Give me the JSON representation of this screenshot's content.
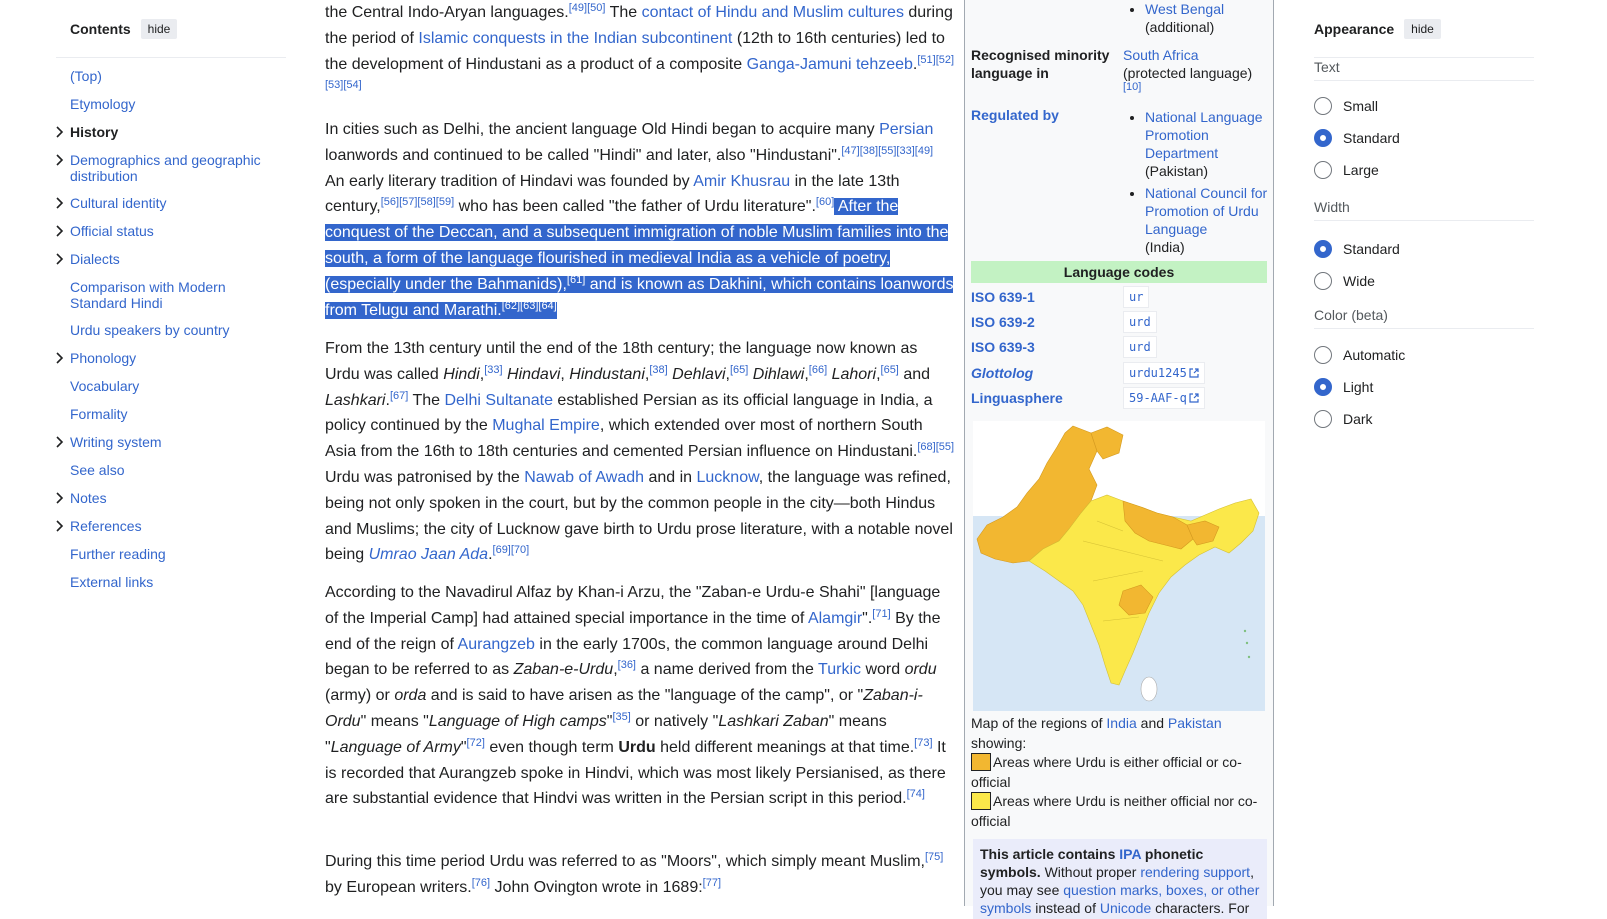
{
  "toc": {
    "title": "Contents",
    "hide_label": "hide",
    "items": [
      {
        "label": "(Top)",
        "expandable": false,
        "active": false
      },
      {
        "label": "Etymology",
        "expandable": false,
        "active": false
      },
      {
        "label": "History",
        "expandable": true,
        "active": true
      },
      {
        "label": "Demographics and geographic distribution",
        "expandable": true,
        "active": false
      },
      {
        "label": "Cultural identity",
        "expandable": true,
        "active": false
      },
      {
        "label": "Official status",
        "expandable": true,
        "active": false
      },
      {
        "label": "Dialects",
        "expandable": true,
        "active": false
      },
      {
        "label": "Comparison with Modern Standard Hindi",
        "expandable": false,
        "active": false
      },
      {
        "label": "Urdu speakers by country",
        "expandable": false,
        "active": false
      },
      {
        "label": "Phonology",
        "expandable": true,
        "active": false
      },
      {
        "label": "Vocabulary",
        "expandable": false,
        "active": false
      },
      {
        "label": "Formality",
        "expandable": false,
        "active": false
      },
      {
        "label": "Writing system",
        "expandable": true,
        "active": false
      },
      {
        "label": "See also",
        "expandable": false,
        "active": false
      },
      {
        "label": "Notes",
        "expandable": true,
        "active": false
      },
      {
        "label": "References",
        "expandable": true,
        "active": false
      },
      {
        "label": "Further reading",
        "expandable": false,
        "active": false
      },
      {
        "label": "External links",
        "expandable": false,
        "active": false
      }
    ]
  },
  "article": {
    "p1": {
      "t1": "the Central Indo-Aryan languages.",
      "r1": "[49][50]",
      "t2": " The ",
      "l1": "contact of Hindu and Muslim cultures",
      "t3": " during the period of ",
      "l2": "Islamic conquests in the Indian subcontinent",
      "t4": " (12th to 16th centuries) led to the development of Hindustani as a product of a composite ",
      "l3": "Ganga-Jamuni tehzeeb",
      "t5": ".",
      "r2": "[51][52][53][54]"
    },
    "p2": {
      "t1": "In cities such as Delhi, the ancient language Old Hindi began to acquire many ",
      "l1": "Persian",
      "t2": " loanwords and continued to be called \"Hindi\" and later, also \"Hindustani\".",
      "r1": "[47][38][55][33][49]",
      "t3": " An early literary tradition of Hindavi was founded by ",
      "l2": "Amir Khusrau",
      "t4": " in the late 13th century,",
      "r2": "[56][57][58][59]",
      "t5": " who has been called \"the father of Urdu literature\".",
      "r3": "[60]",
      "h1": " After the conquest of the Deccan, and a subsequent immigration of noble Muslim families into the south, a form of the language flourished in medieval India as a vehicle of poetry, (especially under the Bahmanids),",
      "r4": "[61]",
      "h2": " and is known as Dakhini, which contains loanwords from Telugu and Marathi.",
      "r5": "[62][63][64]"
    },
    "p3": {
      "t1": "From the 13th century until the end of the 18th century; the language now known as Urdu was called ",
      "i1": "Hindi",
      "t2": ",",
      "r1": "[33]",
      "i2": " Hindavi",
      "t3": ", ",
      "i3": "Hindustani",
      "t4": ",",
      "r2": "[38]",
      "i4": " Dehlavi",
      "t5": ",",
      "r3": "[65]",
      "i5": " Dihlawi",
      "t6": ",",
      "r4": "[66]",
      "i6": " Lahori",
      "t7": ",",
      "r5": "[65]",
      "t8": " and ",
      "i7": "Lashkari",
      "t9": ".",
      "r6": "[67]",
      "t10": " The ",
      "l1": "Delhi Sultanate",
      "t11": " established Persian as its official language in India, a policy continued by the ",
      "l2": "Mughal Empire",
      "t12": ", which extended over most of northern South Asia from the 16th to 18th centuries and cemented Persian influence on Hindustani.",
      "r7": "[68][55]",
      "t13": " Urdu was patronised by the ",
      "l3": "Nawab of Awadh",
      "t14": " and in ",
      "l4": "Lucknow",
      "t15": ", the language was refined, being not only spoken in the court, but by the common people in the city—both Hindus and Muslims; the city of Lucknow gave birth to Urdu prose literature, with a notable novel being ",
      "l5": "Umrao Jaan Ada",
      "t16": ".",
      "r8": "[69][70]"
    },
    "p4": {
      "t1": "According to the Navadirul Alfaz by Khan-i Arzu, the \"Zaban-e Urdu-e Shahi\" [language of the Imperial Camp] had attained special importance in the time of ",
      "l1": "Alamgir",
      "t2": "\".",
      "r1": "[71]",
      "t3": " By the end of the reign of ",
      "l2": "Aurangzeb",
      "t4": " in the early 1700s, the common language around Delhi began to be referred to as ",
      "i1": "Zaban-e-Urdu",
      "t5": ",",
      "r2": "[36]",
      "t6": " a name derived from the ",
      "l3": "Turkic",
      "t7": " word ",
      "i2": "ordu",
      "t8": " (army) or ",
      "i3": "orda",
      "t9": " and is said to have arisen as the \"language of the camp\", or \"",
      "i4": "Zaban-i-Ordu",
      "t10": "\" means \"",
      "i5": "Language of High camps",
      "t11": "\"",
      "r3": "[35]",
      "t12": " or natively \"",
      "i6": "Lashkari Zaban",
      "t13": "\" means \"",
      "i7": "Language of Army",
      "t14": "\"",
      "r4": "[72]",
      "t15": " even though term ",
      "b1": "Urdu",
      "t16": " held different meanings at that time.",
      "r5": "[73]",
      "t17": " It is recorded that Aurangzeb spoke in Hindvi, which was most likely Persianised, as there are substantial evidence that Hindvi was written in the Persian script in this period.",
      "r6": "[74]"
    },
    "p5": {
      "t1": "During this time period Urdu was referred to as \"Moors\", which simply meant Muslim,",
      "r1": "[75]",
      "t2": " by European writers.",
      "r2": "[76]",
      "t3": " John Ovington wrote in 1689:",
      "r3": "[77]"
    }
  },
  "infobox": {
    "wb_link": "West Bengal",
    "wb_note": "(additional)",
    "minority_label": "Recognised minority language in",
    "minority_link": "South Africa",
    "minority_note": "(protected language)",
    "minority_ref": "[10]",
    "regulated_label": "Regulated by",
    "reg1_link": "National Language Promotion Department",
    "reg1_note": "(Pakistan)",
    "reg2_link": "National Council for Promotion of Urdu Language",
    "reg2_note": "(India)",
    "codes_header": "Language codes",
    "codes": [
      {
        "label": "ISO 639-1",
        "value": "ur",
        "external": false,
        "italic": false
      },
      {
        "label": "ISO 639-2",
        "value": "urd",
        "external": false,
        "italic": false
      },
      {
        "label": "ISO 639-3",
        "value": "urd",
        "external": false,
        "italic": false
      },
      {
        "label": "Glottolog",
        "value": "urdu1245",
        "external": true,
        "italic": true
      },
      {
        "label": "Linguasphere",
        "value": "59-AAF-q",
        "external": true,
        "italic": false
      }
    ],
    "caption_t1": "Map of the regions of ",
    "caption_l1": "India",
    "caption_t2": " and ",
    "caption_l2": "Pakistan",
    "caption_t3": " showing:",
    "legend1": "Areas where Urdu is either official or co-official",
    "legend2": "Areas where Urdu is neither official nor co-official",
    "ipa_b1": "This article contains ",
    "ipa_l1": "IPA",
    "ipa_b2": " phonetic symbols.",
    "ipa_t1": " Without proper ",
    "ipa_l2": "rendering support",
    "ipa_t2": ", you may see ",
    "ipa_l3": "question marks, boxes, or other symbols",
    "ipa_t3": " instead of ",
    "ipa_l4": "Unicode",
    "ipa_t4": " characters. For"
  },
  "colors": {
    "link": "#3366cc",
    "highlight": "#3366cc",
    "map_official": "#f2b731",
    "map_nonofficial": "#fbe84a",
    "map_sea": "#d6e6f5",
    "codes_header_bg": "#c3f2c3"
  },
  "appearance": {
    "title": "Appearance",
    "hide_label": "hide",
    "text_title": "Text",
    "text_options": [
      "Small",
      "Standard",
      "Large"
    ],
    "text_selected": "Standard",
    "width_title": "Width",
    "width_options": [
      "Standard",
      "Wide"
    ],
    "width_selected": "Standard",
    "color_title": "Color (beta)",
    "color_options": [
      "Automatic",
      "Light",
      "Dark"
    ],
    "color_selected": "Light"
  }
}
